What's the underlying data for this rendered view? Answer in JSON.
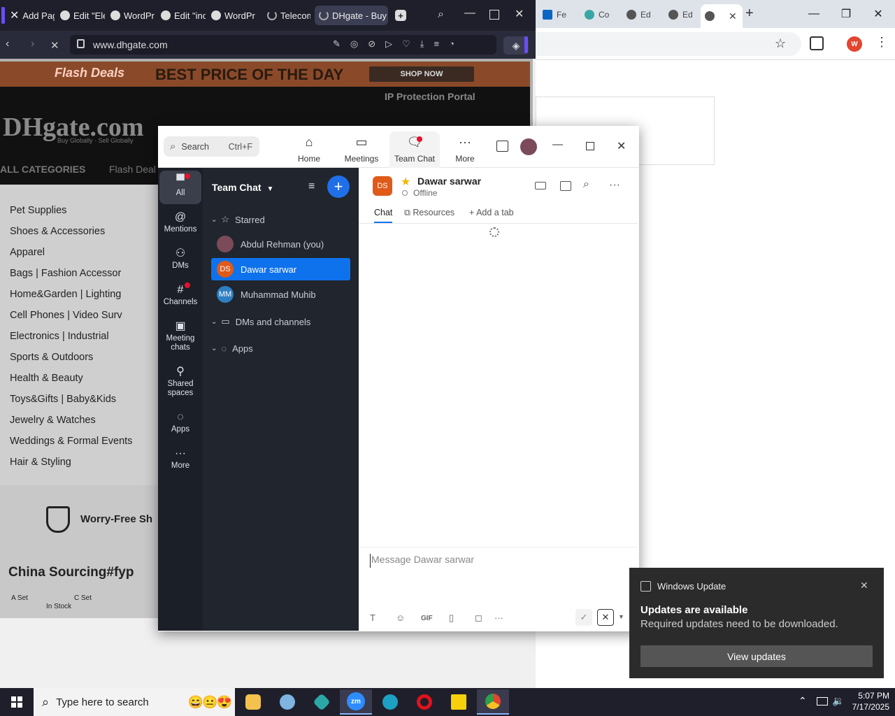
{
  "chrome": {
    "tabs": [
      {
        "label": "Fe",
        "icon": "linkedin-icon"
      },
      {
        "label": "Co",
        "icon": "chatgpt-icon"
      },
      {
        "label": "Ed",
        "icon": "globe-icon"
      },
      {
        "label": "Ed",
        "icon": "globe-icon"
      },
      {
        "label": "",
        "icon": "globe-icon",
        "active": true
      }
    ],
    "new_tab_glyph": "+",
    "profile_initial": "W"
  },
  "dhgate_browser": {
    "tabs": [
      {
        "label": "Add Pag",
        "icon": "x-icon"
      },
      {
        "label": "Edit \"Ele",
        "icon": "wordpress-icon"
      },
      {
        "label": "WordPr",
        "icon": "wordpress-icon"
      },
      {
        "label": "Edit \"inc",
        "icon": "wordpress-icon"
      },
      {
        "label": "WordPr",
        "icon": "wordpress-icon"
      },
      {
        "label": "Telecom",
        "icon": "loading-icon"
      },
      {
        "label": "DHgate - Buy",
        "icon": "loading-icon",
        "active": true
      }
    ],
    "url": "www.dhgate.com",
    "page": {
      "flash_deals": "Flash Deals",
      "best_price": "BEST PRICE OF THE DAY",
      "shop_now": "SHOP NOW",
      "ip_portal": "IP Protection Portal",
      "logo": "DHgate.com",
      "logo_tagline": "Buy Globally · Sell Globally",
      "all_categories": "ALL CATEGORIES",
      "flash_deals_nav": "Flash Deal",
      "categories": [
        "Pet Supplies",
        "Shoes & Accessories",
        "Apparel",
        "Bags  |  Fashion Accessor",
        "Home&Garden  |  Lighting",
        "Cell Phones  |  Video Surv",
        "Electronics  |  Industrial",
        "Sports & Outdoors",
        "Health & Beauty",
        "Toys&Gifts  |  Baby&Kids",
        "Jewelry & Watches",
        "Weddings & Formal Events",
        "Hair & Styling"
      ],
      "worry_free": "Worry-Free Sh",
      "china_sourcing": "China Sourcing#fyp",
      "a_set": "A Set",
      "c_set": "C Set",
      "in_stock": "In Stock"
    }
  },
  "zoom": {
    "search": {
      "label": "Search",
      "shortcut": "Ctrl+F"
    },
    "nav": [
      {
        "label": "Home",
        "icon": "home-icon"
      },
      {
        "label": "Meetings",
        "icon": "video-icon"
      },
      {
        "label": "Team Chat",
        "icon": "chat-icon",
        "active": true
      },
      {
        "label": "More",
        "icon": "ellipsis-icon"
      }
    ],
    "rail": [
      {
        "label": "All",
        "icon": "chat-bubble-icon",
        "active": true
      },
      {
        "label": "Mentions",
        "icon": "at-icon"
      },
      {
        "label": "DMs",
        "icon": "people-icon"
      },
      {
        "label": "Channels",
        "icon": "hash-icon"
      },
      {
        "label": "Meeting chats",
        "icon": "calendar-icon"
      },
      {
        "label": "Shared spaces",
        "icon": "share-icon"
      },
      {
        "label": "Apps",
        "icon": "apps-icon"
      },
      {
        "label": "More",
        "icon": "ellipsis-icon"
      }
    ],
    "sidebar": {
      "title": "Team Chat",
      "starred": "Starred",
      "contacts": [
        {
          "name": "Abdul Rehman (you)",
          "initials": "",
          "color": "#7b4b5a"
        },
        {
          "name": "Dawar sarwar",
          "initials": "DS",
          "color": "#e05a1a",
          "selected": true
        },
        {
          "name": "Muhammad Muhib",
          "initials": "MM",
          "color": "#2d7fc1"
        }
      ],
      "dms_and_channels": "DMs and channels",
      "apps": "Apps"
    },
    "chat": {
      "contact_initials": "DS",
      "contact_name": "Dawar sarwar",
      "status": "Offline",
      "tabs": [
        {
          "label": "Chat",
          "active": true
        },
        {
          "label": "Resources"
        },
        {
          "label": "Add a tab"
        }
      ],
      "composer_placeholder": "Message Dawar sarwar",
      "gif_label": "GIF"
    }
  },
  "windows_update": {
    "app": "Windows Update",
    "title": "Updates are available",
    "body": "Required updates need to be downloaded.",
    "button": "View updates"
  },
  "taskbar": {
    "search_placeholder": "Type here to search",
    "time": "5:07 PM",
    "date": "7/17/2025",
    "apps": [
      {
        "name": "file-explorer",
        "color": "#f2c14e"
      },
      {
        "name": "app-blue",
        "color": "#7fb3e0"
      },
      {
        "name": "app-teal",
        "color": "#2aa8a8"
      },
      {
        "name": "zoom",
        "color": "#2d8cff",
        "label": "zm"
      },
      {
        "name": "edge",
        "color": "#1da0c3"
      },
      {
        "name": "opera",
        "color": "#e0121b"
      },
      {
        "name": "sticky-notes",
        "color": "#f6d10b"
      },
      {
        "name": "chrome",
        "color": "#e3452f"
      }
    ]
  }
}
